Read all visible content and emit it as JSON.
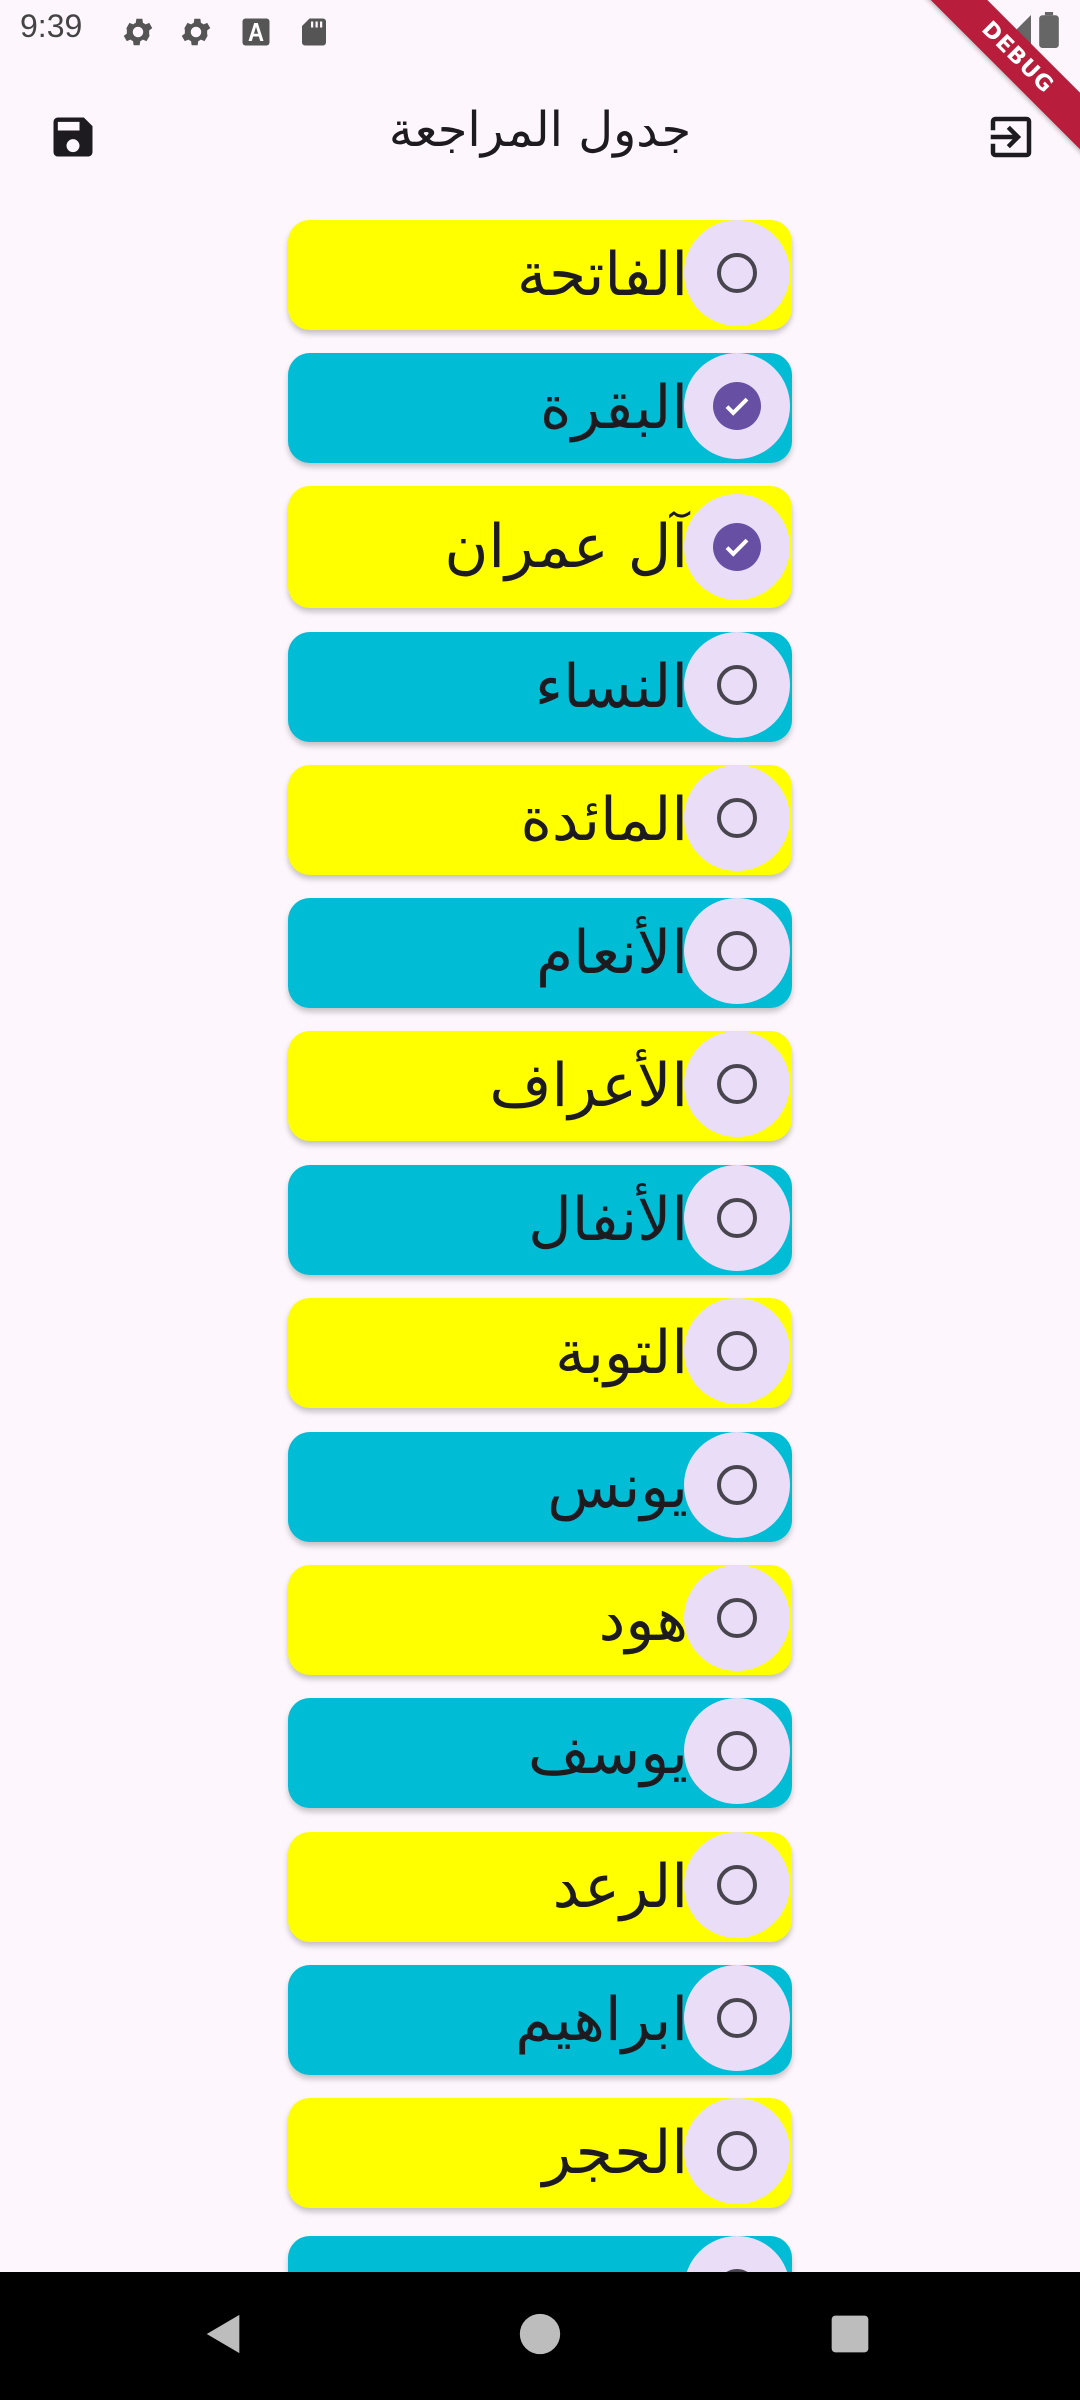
{
  "status_bar": {
    "time": "9:39",
    "icons": [
      "settings-icon",
      "settings-icon",
      "font-icon",
      "sd-card-icon"
    ],
    "right_icons": [
      "wifi-off-icon",
      "signal-icon",
      "battery-icon"
    ]
  },
  "debug_banner": "DEBUG",
  "app_bar": {
    "title": "جدول المراجعة",
    "left_icon": "save-icon",
    "right_icon": "logout-icon"
  },
  "surahs": [
    {
      "name": "الفاتحة",
      "color": "yellow",
      "checked": false
    },
    {
      "name": "البقرة",
      "color": "cyan",
      "checked": true
    },
    {
      "name": "آل عمران",
      "color": "yellow",
      "checked": true
    },
    {
      "name": "النساء",
      "color": "cyan",
      "checked": false
    },
    {
      "name": "المائدة",
      "color": "yellow",
      "checked": false
    },
    {
      "name": "الأنعام",
      "color": "cyan",
      "checked": false
    },
    {
      "name": "الأعراف",
      "color": "yellow",
      "checked": false
    },
    {
      "name": "الأنفال",
      "color": "cyan",
      "checked": false
    },
    {
      "name": "التوبة",
      "color": "yellow",
      "checked": false
    },
    {
      "name": "يونس",
      "color": "cyan",
      "checked": false
    },
    {
      "name": "هود",
      "color": "yellow",
      "checked": false
    },
    {
      "name": "يوسف",
      "color": "cyan",
      "checked": false
    },
    {
      "name": "الرعد",
      "color": "yellow",
      "checked": false
    },
    {
      "name": "ابراهيم",
      "color": "cyan",
      "checked": false
    },
    {
      "name": "الحجر",
      "color": "yellow",
      "checked": false
    },
    {
      "name": "",
      "color": "cyan",
      "checked": false
    }
  ],
  "colors": {
    "yellow": "#FFFF00",
    "cyan": "#00BCD4",
    "check_bg": "#E9DDF8",
    "check_fill": "#6750A4"
  },
  "nav": [
    "back-icon",
    "home-icon",
    "recents-icon"
  ]
}
